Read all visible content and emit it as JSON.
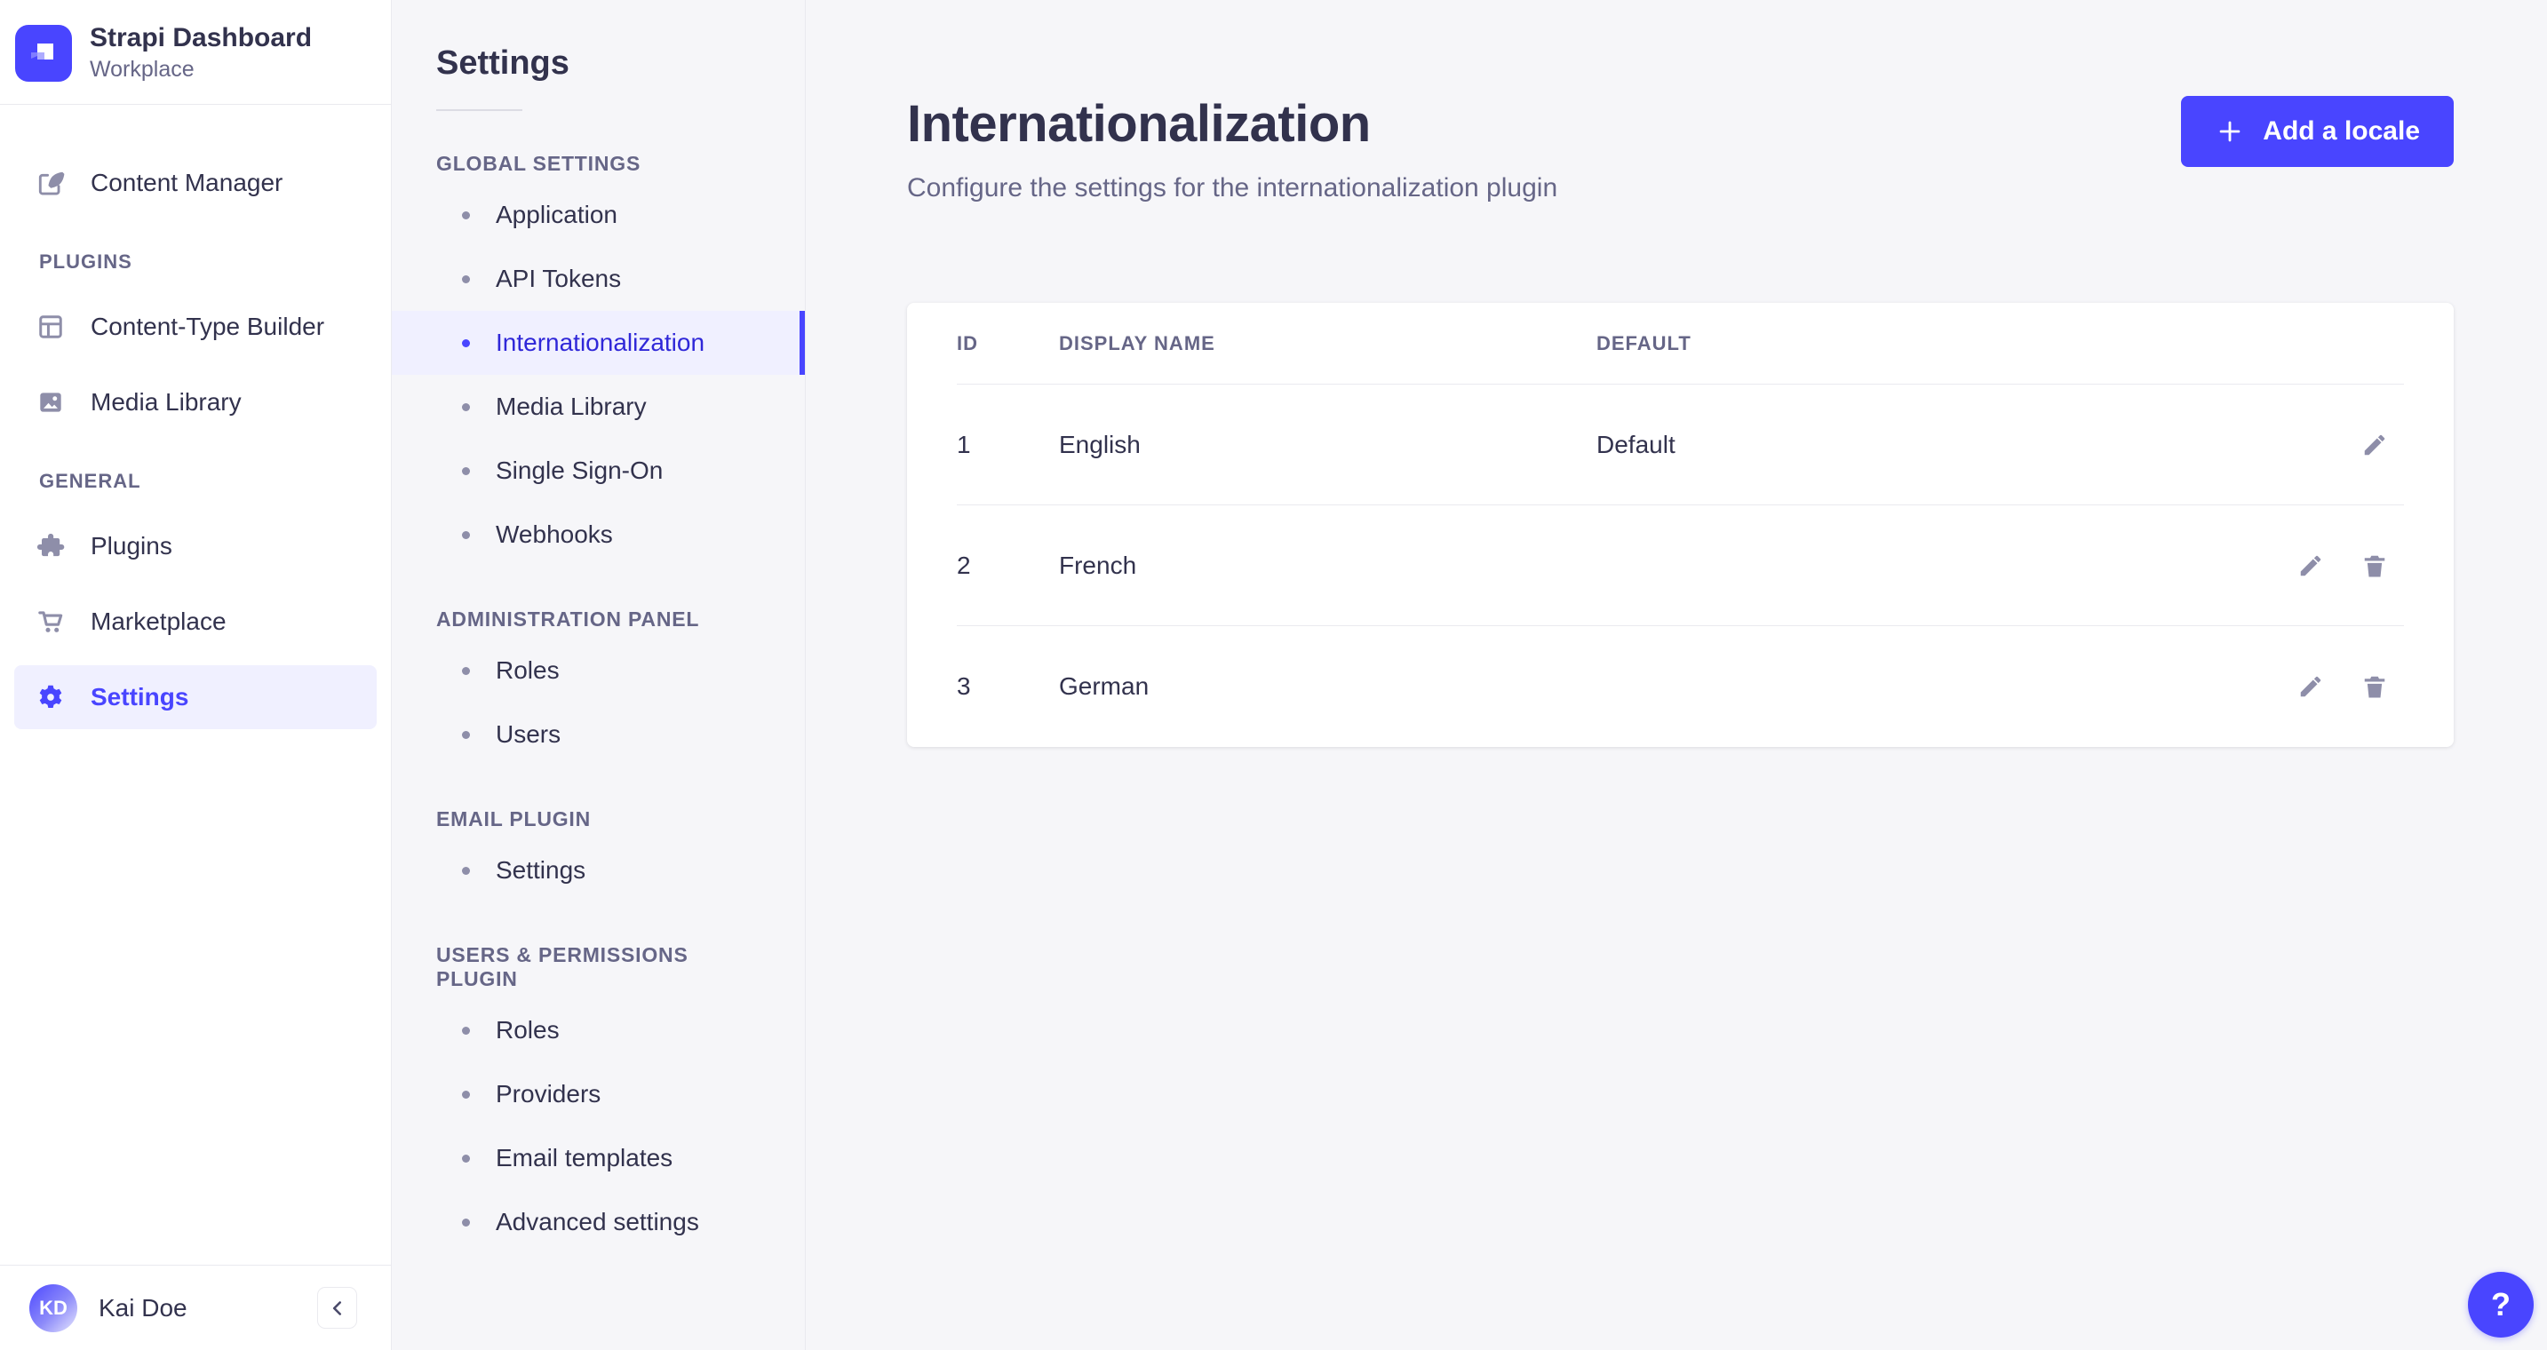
{
  "brand": {
    "title": "Strapi Dashboard",
    "subtitle": "Workplace",
    "logo_icon": "strapi-logo-icon"
  },
  "colors": {
    "primary": "#4945ff",
    "primary_light_bg": "#f0f0ff",
    "text": "#32324d",
    "text_secondary": "#666687",
    "icon": "#8e8ea9",
    "border": "#eaeaef",
    "panel_bg": "#f6f6f9",
    "surface": "#ffffff"
  },
  "sidebar": {
    "top_item": {
      "label": "Content Manager",
      "icon": "content-manager-icon"
    },
    "sections": [
      {
        "label": "PLUGINS",
        "items": [
          {
            "label": "Content-Type Builder",
            "icon": "content-type-builder-icon"
          },
          {
            "label": "Media Library",
            "icon": "media-library-icon"
          }
        ]
      },
      {
        "label": "GENERAL",
        "items": [
          {
            "label": "Plugins",
            "icon": "plugins-icon"
          },
          {
            "label": "Marketplace",
            "icon": "marketplace-icon"
          },
          {
            "label": "Settings",
            "icon": "settings-gear-icon",
            "selected": true
          }
        ]
      }
    ],
    "user": {
      "initials": "KD",
      "name": "Kai Doe"
    },
    "collapse_icon": "chevron-left-icon"
  },
  "settings_nav": {
    "title": "Settings",
    "sections": [
      {
        "label": "GLOBAL SETTINGS",
        "items": [
          {
            "label": "Application"
          },
          {
            "label": "API Tokens"
          },
          {
            "label": "Internationalization",
            "selected": true
          },
          {
            "label": "Media Library"
          },
          {
            "label": "Single Sign-On"
          },
          {
            "label": "Webhooks"
          }
        ]
      },
      {
        "label": "ADMINISTRATION PANEL",
        "items": [
          {
            "label": "Roles"
          },
          {
            "label": "Users"
          }
        ]
      },
      {
        "label": "EMAIL PLUGIN",
        "items": [
          {
            "label": "Settings"
          }
        ]
      },
      {
        "label": "USERS & PERMISSIONS PLUGIN",
        "items": [
          {
            "label": "Roles"
          },
          {
            "label": "Providers"
          },
          {
            "label": "Email templates"
          },
          {
            "label": "Advanced settings"
          }
        ]
      }
    ]
  },
  "main": {
    "title": "Internationalization",
    "subtitle": "Configure the settings for the internationalization plugin",
    "add_button": {
      "label": "Add a locale",
      "icon": "plus-icon"
    },
    "table": {
      "headers": {
        "id": "ID",
        "display_name": "DISPLAY NAME",
        "default": "DEFAULT"
      },
      "rows": [
        {
          "id": "1",
          "display_name": "English",
          "default": "Default",
          "actions": [
            "edit"
          ]
        },
        {
          "id": "2",
          "display_name": "French",
          "default": "",
          "actions": [
            "edit",
            "delete"
          ]
        },
        {
          "id": "3",
          "display_name": "German",
          "default": "",
          "actions": [
            "edit",
            "delete"
          ]
        }
      ]
    }
  },
  "help": {
    "label": "?",
    "icon": "question-mark-icon"
  }
}
